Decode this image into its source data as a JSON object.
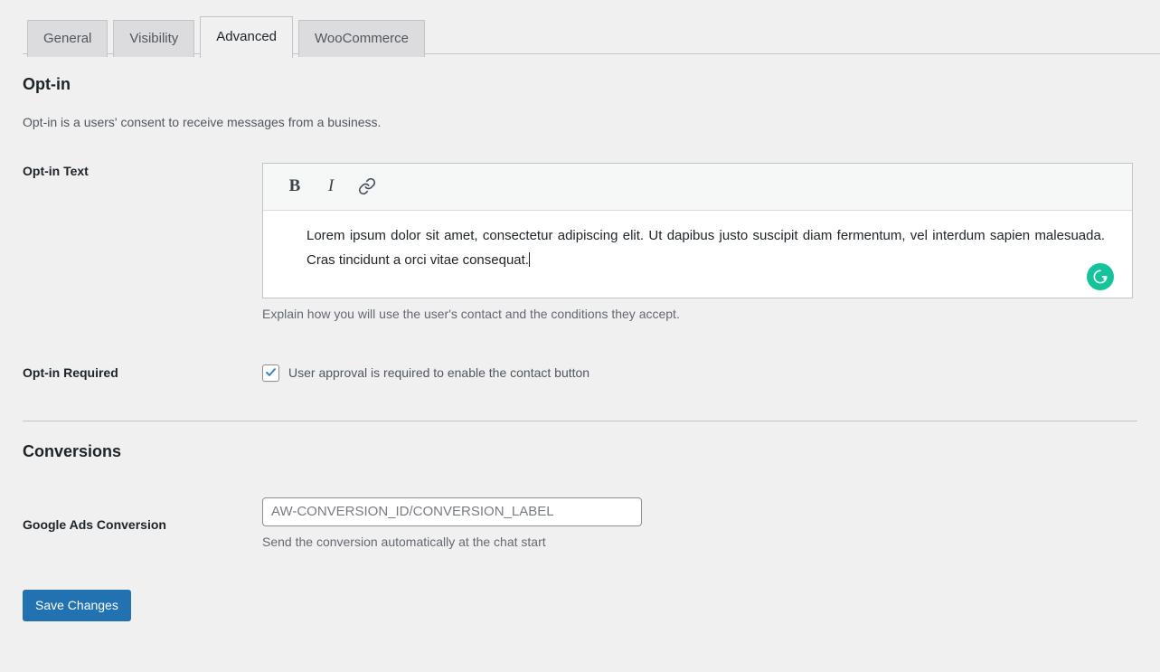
{
  "tabs": [
    {
      "label": "General",
      "active": false
    },
    {
      "label": "Visibility",
      "active": false
    },
    {
      "label": "Advanced",
      "active": true
    },
    {
      "label": "WooCommerce",
      "active": false
    }
  ],
  "optin": {
    "heading": "Opt-in",
    "description": "Opt-in is a users' consent to receive messages from a business.",
    "text_label": "Opt-in Text",
    "toolbar": {
      "bold": "B",
      "italic": "I",
      "link_icon": "link-icon"
    },
    "editor_value": "Lorem ipsum dolor sit amet, consectetur adipiscing elit. Ut dapibus justo suscipit diam fermentum, vel interdum sapien malesuada. Cras tincidunt a orci vitae consequat.",
    "editor_help": "Explain how you will use the user's contact and the conditions they accept.",
    "grammarly_glyph": "G",
    "required_label": "Opt-in Required",
    "required_checkbox_label": "User approval is required to enable the contact button",
    "required_checked": true
  },
  "conversions": {
    "heading": "Conversions",
    "google_ads_label": "Google Ads Conversion",
    "google_ads_value": "",
    "google_ads_placeholder": "AW-CONVERSION_ID/CONVERSION_LABEL",
    "google_ads_help": "Send the conversion automatically at the chat start"
  },
  "footer": {
    "save_label": "Save Changes"
  },
  "colors": {
    "accent": "#2271b1",
    "grammarly": "#15c39a",
    "page_bg": "#f0f0f1",
    "border": "#c3c4c7"
  }
}
